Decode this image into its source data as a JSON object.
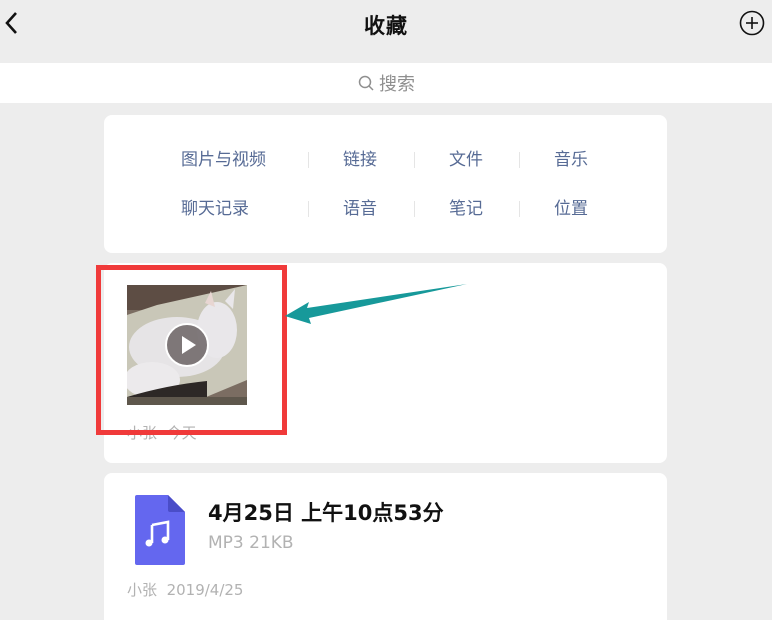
{
  "nav": {
    "title": "收藏",
    "back_icon": "chevron-left-icon",
    "add_icon": "plus-circle-icon"
  },
  "search": {
    "placeholder": "搜索",
    "icon": "search-icon"
  },
  "categories": {
    "row1": [
      "图片与视频",
      "链接",
      "文件",
      "音乐"
    ],
    "row2": [
      "聊天记录",
      "语音",
      "笔记",
      "位置"
    ]
  },
  "items": [
    {
      "type": "video",
      "thumbnail": "white cat video thumbnail",
      "play_icon": "play-icon",
      "author": "小张",
      "time": "今天"
    },
    {
      "type": "file",
      "icon": "music-file-icon",
      "name": "4月25日 上午10点53分",
      "info": "MP3 21KB",
      "author": "小张",
      "time": "2019/4/25"
    }
  ],
  "annotation": {
    "highlight_color": "#f03a3a",
    "arrow_color": "#17999a"
  },
  "colors": {
    "link": "#576b95",
    "file_icon": "#6467ef",
    "background": "#ededed"
  }
}
